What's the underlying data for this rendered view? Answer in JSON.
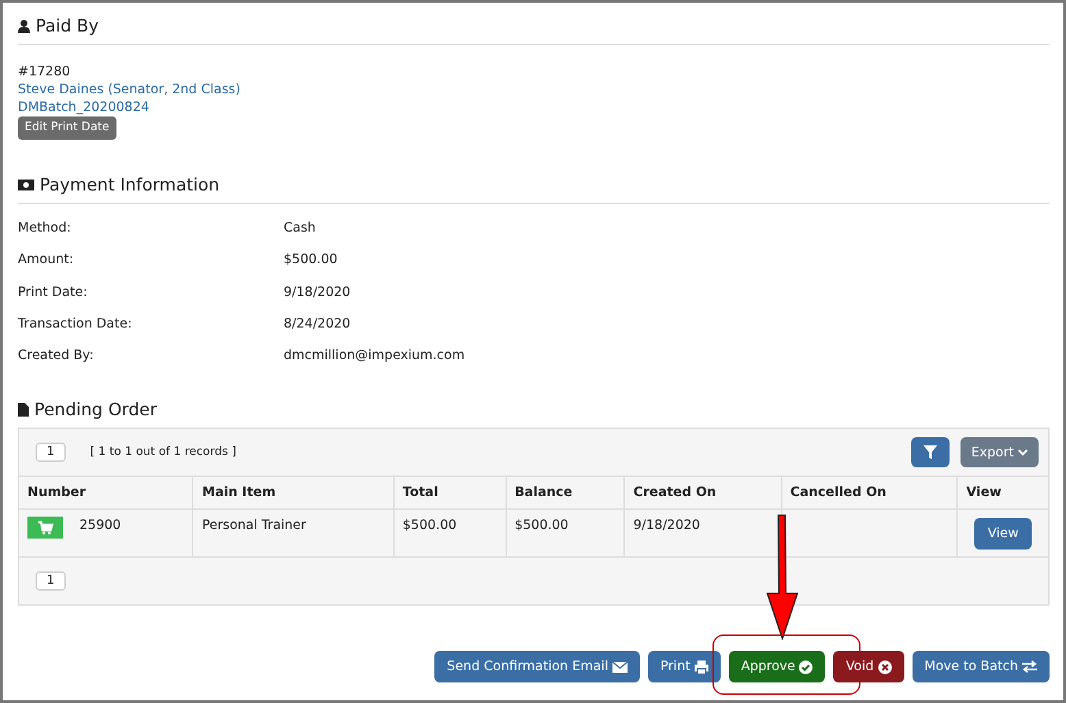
{
  "paid_by": {
    "title": "Paid By",
    "number": "#17280",
    "name": "Steve Daines (Senator, 2nd Class)",
    "batch": "DMBatch_20200824",
    "edit_button": "Edit Print Date"
  },
  "payment_information": {
    "title": "Payment Information",
    "fields": [
      {
        "label": "Method:",
        "value": "Cash"
      },
      {
        "label": "Amount:",
        "value": "$500.00"
      },
      {
        "label": "Print Date:",
        "value": "9/18/2020"
      },
      {
        "label": "Transaction Date:",
        "value": "8/24/2020"
      },
      {
        "label": "Created By:",
        "value": "dmcmillion@impexium.com"
      }
    ]
  },
  "pending_order": {
    "title": "Pending Order",
    "page": "1",
    "records": "[ 1 to 1 out of 1 records ]",
    "export": "Export",
    "bottom_page": "1",
    "columns": [
      "Number",
      "Main Item",
      "Total",
      "Balance",
      "Created On",
      "Cancelled On",
      "View"
    ],
    "rows": [
      {
        "number": "25900",
        "main_item": "Personal Trainer",
        "total": "$500.00",
        "balance": "$500.00",
        "created_on": "9/18/2020",
        "cancelled_on": "",
        "view": "View"
      }
    ]
  },
  "actions": [
    {
      "label": "Send Confirmation Email",
      "kind": "mail",
      "highlighted": false
    },
    {
      "label": "Print",
      "kind": "print",
      "highlighted": false
    },
    {
      "label": "Approve",
      "kind": "approve",
      "highlighted": true
    },
    {
      "label": "Void",
      "kind": "void",
      "highlighted": false
    },
    {
      "label": "Move to Batch",
      "kind": "move",
      "highlighted": false
    }
  ]
}
